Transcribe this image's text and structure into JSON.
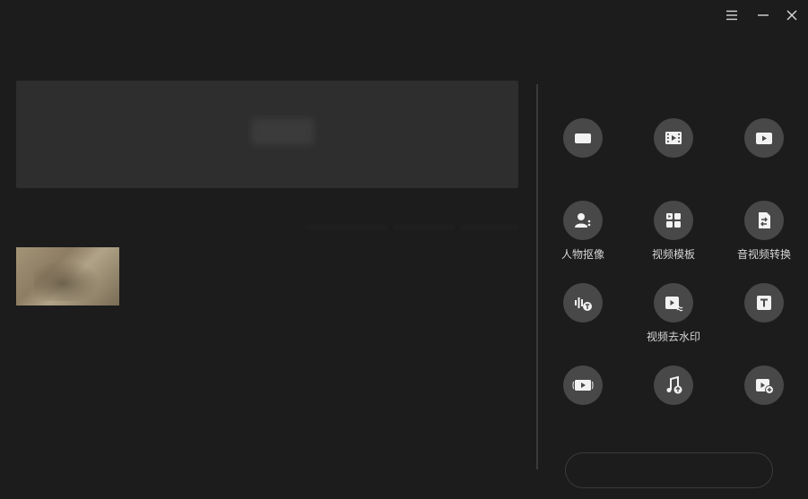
{
  "window": {
    "menu_icon": "hamburger-icon",
    "minimize_icon": "minimize-icon",
    "close_icon": "close-icon"
  },
  "header": {
    "title": "",
    "subtitle": "",
    "top_right_link": ""
  },
  "upload": {
    "hint": ""
  },
  "library": {
    "section_label": "",
    "filters": [
      "",
      "",
      ""
    ],
    "items": [
      {
        "caption": ""
      }
    ]
  },
  "tools": {
    "header": "",
    "items": [
      {
        "icon": "camera-icon",
        "label": "",
        "blurred": true
      },
      {
        "icon": "film-icon",
        "label": "",
        "blurred": true
      },
      {
        "icon": "play-icon",
        "label": "",
        "blurred": true
      },
      {
        "icon": "portrait-icon",
        "label": "人物抠像",
        "blurred": false
      },
      {
        "icon": "template-icon",
        "label": "视频模板",
        "blurred": false
      },
      {
        "icon": "convert-icon",
        "label": "音视频转换",
        "blurred": false
      },
      {
        "icon": "audio-text-icon",
        "label": "",
        "blurred": true
      },
      {
        "icon": "video-watermark-icon",
        "label": "视频去水印",
        "blurred": false
      },
      {
        "icon": "text-icon",
        "label": "",
        "blurred": true
      },
      {
        "icon": "video-play-icon",
        "label": "",
        "blurred": true
      },
      {
        "icon": "music-icon",
        "label": "",
        "blurred": true
      },
      {
        "icon": "video-add-icon",
        "label": "",
        "blurred": true
      }
    ]
  },
  "bottom_button": {
    "label": ""
  },
  "colors": {
    "background": "#1c1c1c",
    "panel": "#2e2e2e",
    "tool_circle": "#484848",
    "text": "#d6d6d6"
  }
}
